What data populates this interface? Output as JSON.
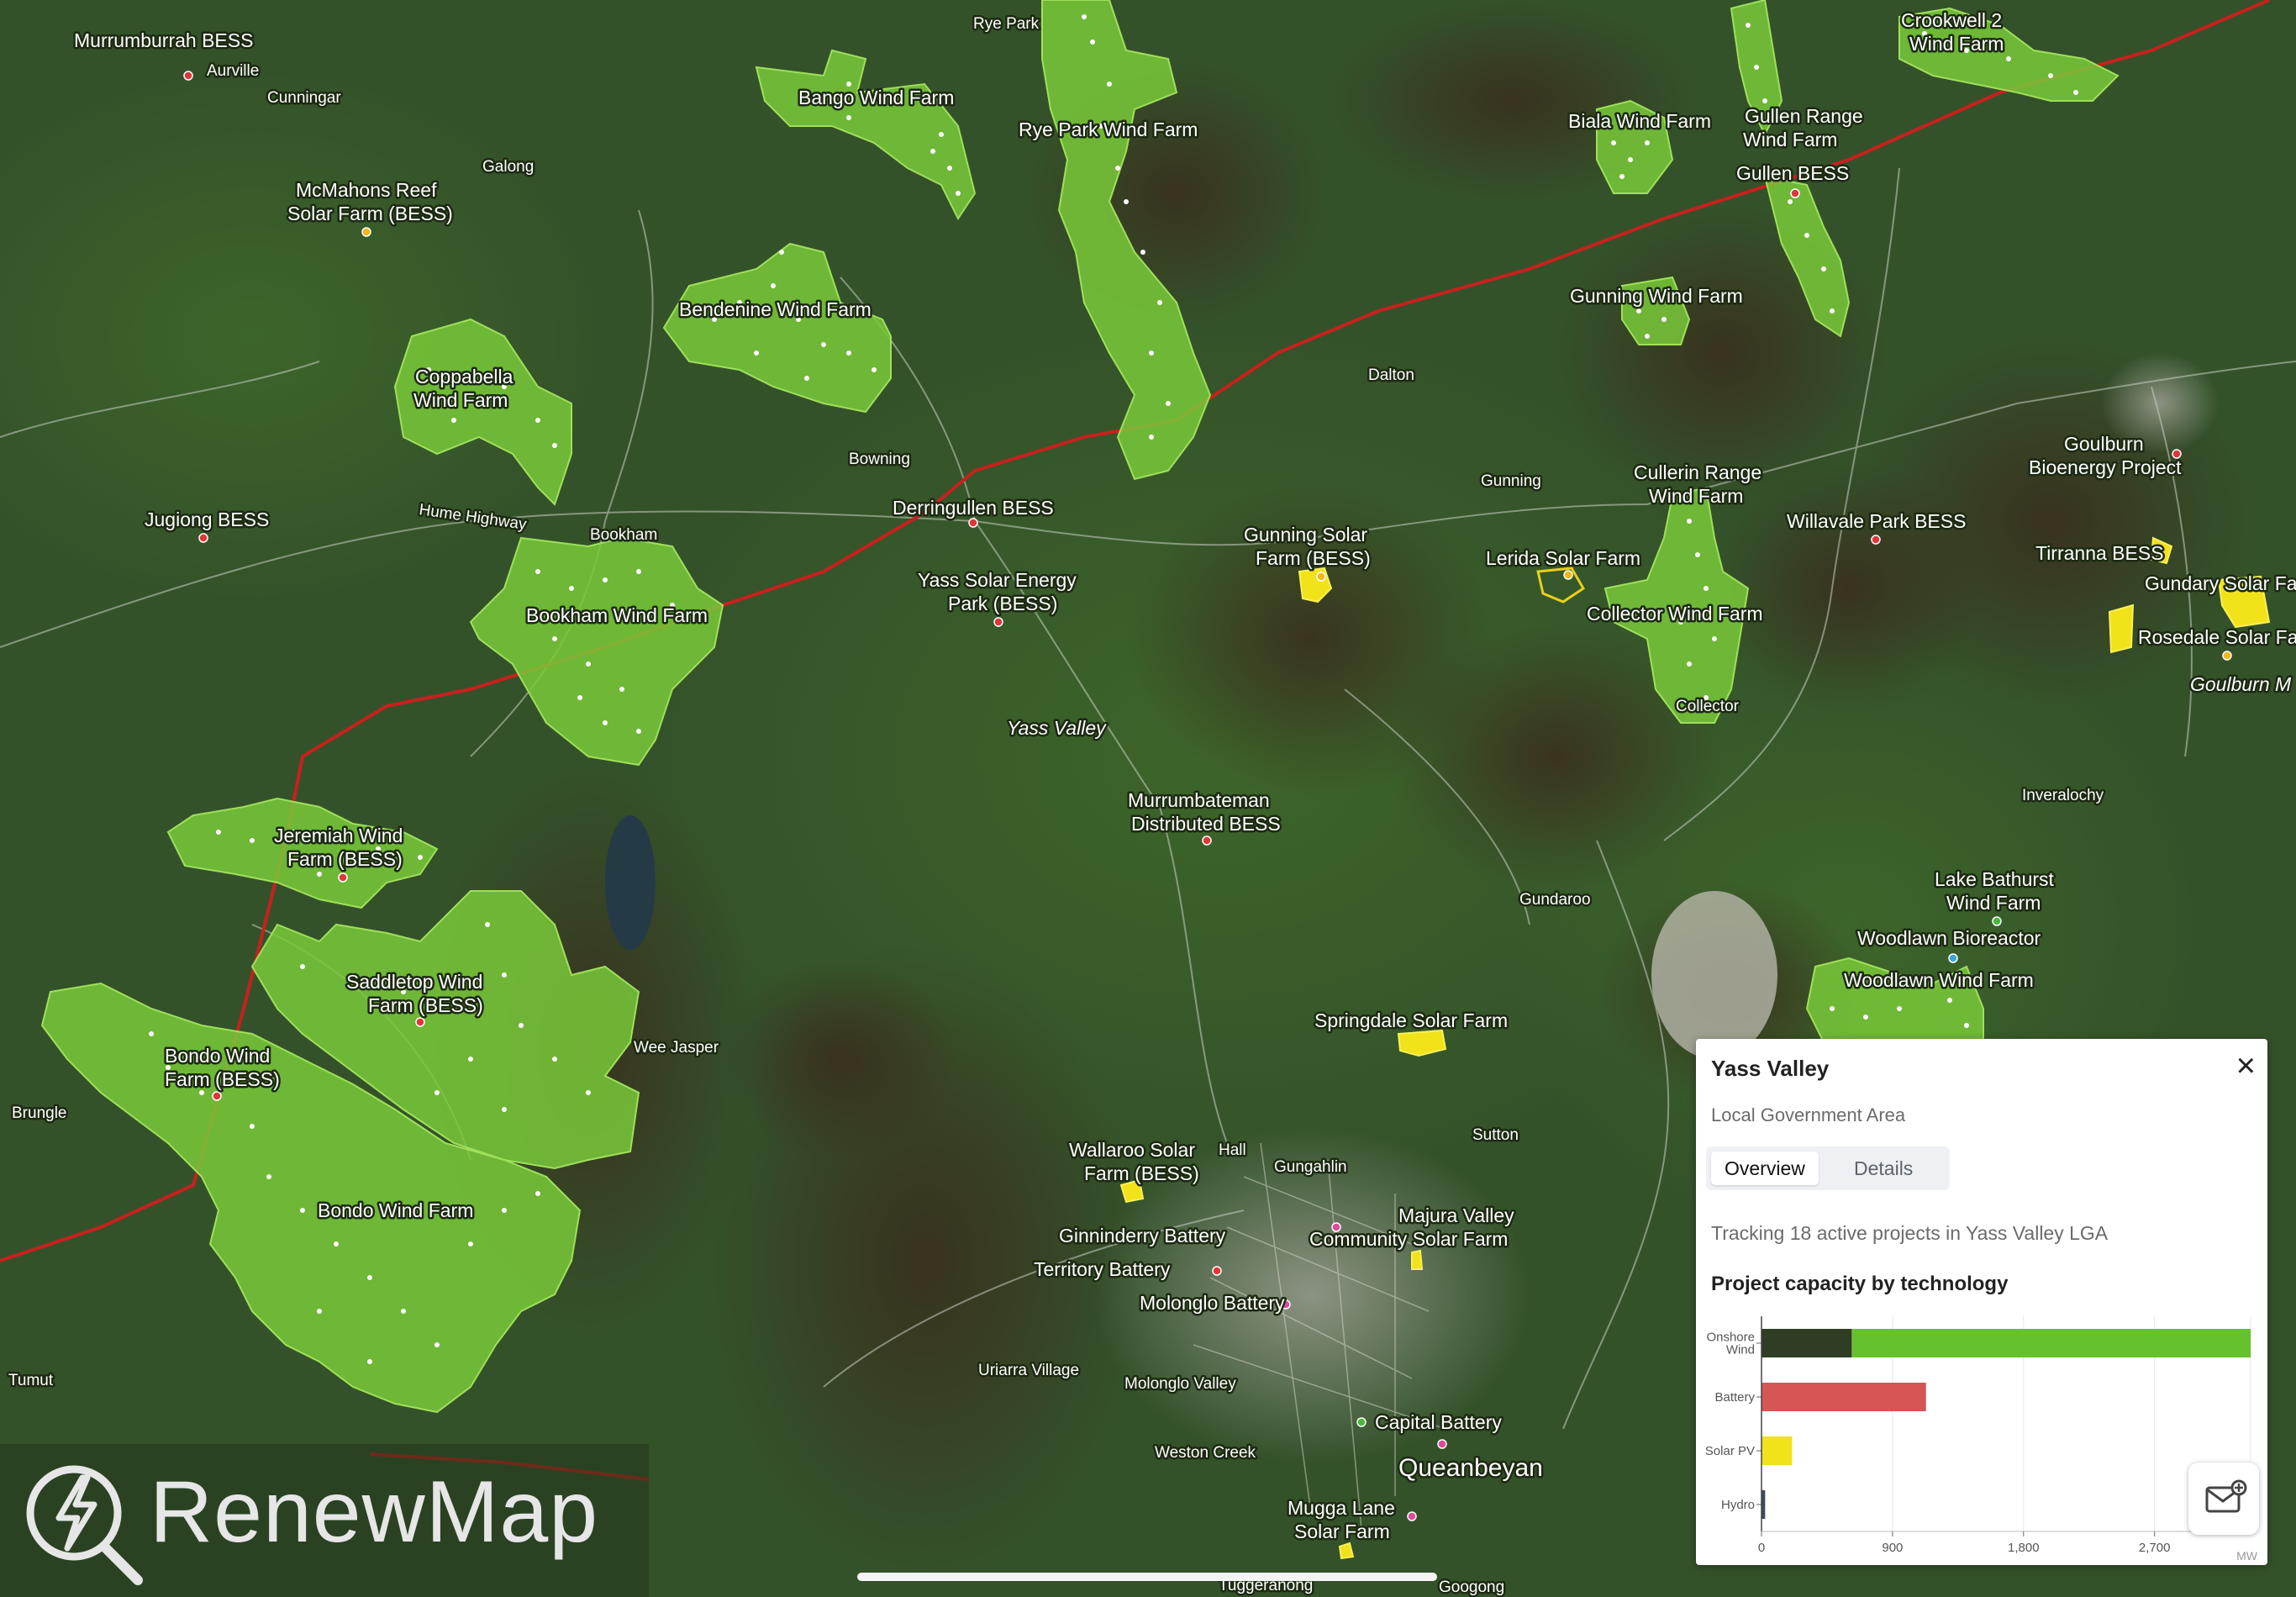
{
  "map": {
    "labels": [
      {
        "text": "Murrumburrah BESS",
        "cls": "mid"
      },
      {
        "text": "Aurville",
        "cls": "small"
      },
      {
        "text": "Cunningar",
        "cls": "small"
      },
      {
        "text": "Rye Park",
        "cls": "small"
      },
      {
        "text": "Bango Wind Farm",
        "cls": "mid"
      },
      {
        "text": "Rye Park Wind Farm",
        "cls": "mid"
      },
      {
        "text": "Crookwell 2",
        "cls": "mid"
      },
      {
        "text": "Wind Farm",
        "cls": "mid"
      },
      {
        "text": "Biala Wind Farm",
        "cls": "mid"
      },
      {
        "text": "Gullen Range",
        "cls": "mid"
      },
      {
        "text": "Wind Farm",
        "cls": "mid"
      },
      {
        "text": "Gullen BESS",
        "cls": "mid"
      },
      {
        "text": "McMahons Reef",
        "cls": "mid"
      },
      {
        "text": "Solar Farm (BESS)",
        "cls": "mid"
      },
      {
        "text": "Galong",
        "cls": "small"
      },
      {
        "text": "Bendenine Wind Farm",
        "cls": "mid"
      },
      {
        "text": "Gunning Wind Farm",
        "cls": "mid"
      },
      {
        "text": "Coppabella",
        "cls": "mid"
      },
      {
        "text": "Wind Farm",
        "cls": "mid"
      },
      {
        "text": "Dalton",
        "cls": "small"
      },
      {
        "text": "Goulburn",
        "cls": "mid"
      },
      {
        "text": "Bioenergy Project",
        "cls": "mid"
      },
      {
        "text": "Bowning",
        "cls": "small"
      },
      {
        "text": "Gunning",
        "cls": "small"
      },
      {
        "text": "Cullerin Range",
        "cls": "mid"
      },
      {
        "text": "Wind Farm",
        "cls": "mid"
      },
      {
        "text": "Jugiong BESS",
        "cls": "mid"
      },
      {
        "text": "Hume Highway",
        "cls": "small"
      },
      {
        "text": "Derringullen BESS",
        "cls": "mid"
      },
      {
        "text": "Willavale Park BESS",
        "cls": "mid"
      },
      {
        "text": "Bookham",
        "cls": "small"
      },
      {
        "text": "Gunning Solar",
        "cls": "mid"
      },
      {
        "text": "Farm (BESS)",
        "cls": "mid"
      },
      {
        "text": "Lerida Solar Farm",
        "cls": "mid"
      },
      {
        "text": "Tirranna BESS",
        "cls": "mid"
      },
      {
        "text": "Gundary Solar Fa",
        "cls": "mid"
      },
      {
        "text": "Yass Solar Energy",
        "cls": "mid"
      },
      {
        "text": "Park (BESS)",
        "cls": "mid"
      },
      {
        "text": "Bookham Wind Farm",
        "cls": "mid"
      },
      {
        "text": "Collector Wind Farm",
        "cls": "mid"
      },
      {
        "text": "Rosedale Solar Fa",
        "cls": "mid"
      },
      {
        "text": "Goulburn M",
        "cls": "mid"
      },
      {
        "text": "Collector",
        "cls": "small"
      },
      {
        "text": "Yass Valley",
        "cls": "mid"
      },
      {
        "text": "Murrumbateman",
        "cls": "mid"
      },
      {
        "text": "Distributed BESS",
        "cls": "mid"
      },
      {
        "text": "Inveralochy",
        "cls": "small"
      },
      {
        "text": "Jeremiah Wind",
        "cls": "mid"
      },
      {
        "text": "Farm (BESS)",
        "cls": "mid"
      },
      {
        "text": "Lake Bathurst",
        "cls": "mid"
      },
      {
        "text": "Wind Farm",
        "cls": "mid"
      },
      {
        "text": "Gundaroo",
        "cls": "small"
      },
      {
        "text": "Woodlawn Bioreactor",
        "cls": "mid"
      },
      {
        "text": "Woodlawn Wind Farm",
        "cls": "mid"
      },
      {
        "text": "Saddletop Wind",
        "cls": "mid"
      },
      {
        "text": "Farm (BESS)",
        "cls": "mid"
      },
      {
        "text": "Springdale Solar Farm",
        "cls": "mid"
      },
      {
        "text": "Bondo Wind",
        "cls": "mid"
      },
      {
        "text": "Farm (BESS)",
        "cls": "mid"
      },
      {
        "text": "Wee Jasper",
        "cls": "small"
      },
      {
        "text": "Brungle",
        "cls": "small"
      },
      {
        "text": "Sutton",
        "cls": "small"
      },
      {
        "text": "Wallaroo Solar",
        "cls": "mid"
      },
      {
        "text": "Farm (BESS)",
        "cls": "mid"
      },
      {
        "text": "Hall",
        "cls": "small"
      },
      {
        "text": "Gungahlin",
        "cls": "small"
      },
      {
        "text": "Bondo Wind Farm",
        "cls": "mid"
      },
      {
        "text": "Majura Valley",
        "cls": "mid"
      },
      {
        "text": "Community Solar Farm",
        "cls": "mid"
      },
      {
        "text": "Ginninderry Battery",
        "cls": "mid"
      },
      {
        "text": "Territory Battery",
        "cls": "mid"
      },
      {
        "text": "Molonglo Battery",
        "cls": "mid"
      },
      {
        "text": "Tumut",
        "cls": "small"
      },
      {
        "text": "Uriarra Village",
        "cls": "small"
      },
      {
        "text": "Molonglo Valley",
        "cls": "small"
      },
      {
        "text": "Capital Battery",
        "cls": "mid"
      },
      {
        "text": "Weston Creek",
        "cls": "small"
      },
      {
        "text": "Queanbeyan",
        "cls": "city"
      },
      {
        "text": "Mugga Lane",
        "cls": "mid"
      },
      {
        "text": "Solar Farm",
        "cls": "mid"
      },
      {
        "text": "Tuggeranong",
        "cls": "small"
      },
      {
        "text": "Googong",
        "cls": "small"
      }
    ]
  },
  "logo": {
    "text": "RenewMap"
  },
  "panel": {
    "title": "Yass Valley",
    "subtitle": "Local Government Area",
    "tabs": [
      {
        "label": "Overview",
        "active": true
      },
      {
        "label": "Details",
        "active": false
      }
    ],
    "description": "Tracking 18 active projects in Yass Valley LGA",
    "chart_title": "Project capacity by technology",
    "close_icon": "close-icon"
  },
  "chart_data": {
    "type": "bar",
    "orientation": "horizontal",
    "title": "Project capacity by technology",
    "categories": [
      "Onshore Wind",
      "Battery",
      "Solar PV",
      "Hydro"
    ],
    "category_tick_lines": [
      [
        "Onshore",
        "Wind"
      ],
      [
        "Battery"
      ],
      [
        "Solar PV"
      ],
      [
        "Hydro"
      ]
    ],
    "series": [
      {
        "color": "#2e3d24",
        "values": [
          620,
          0,
          0,
          0
        ]
      },
      {
        "color": "#66c22c",
        "values": [
          2740,
          1130,
          210,
          25
        ]
      }
    ],
    "segment_colors": {
      "Onshore Wind": [
        "#2e3d24",
        "#66c22c"
      ],
      "Battery": [
        "#d65555"
      ],
      "Solar PV": [
        "#f2e21a"
      ],
      "Hydro": [
        "#3a4a63"
      ]
    },
    "xlim": [
      0,
      3360
    ],
    "xticks": [
      "0",
      "900",
      "1,800",
      "2,700"
    ],
    "xtick_values": [
      0,
      900,
      1800,
      2700
    ],
    "xunit": "MW",
    "grid": true
  },
  "fab": {
    "icon": "mail-add-icon"
  },
  "colors": {
    "wind_area": "#79c93a",
    "solar_area": "#f2e21a",
    "transmission_line": "#c8201e",
    "project_point": "#e0353a"
  }
}
